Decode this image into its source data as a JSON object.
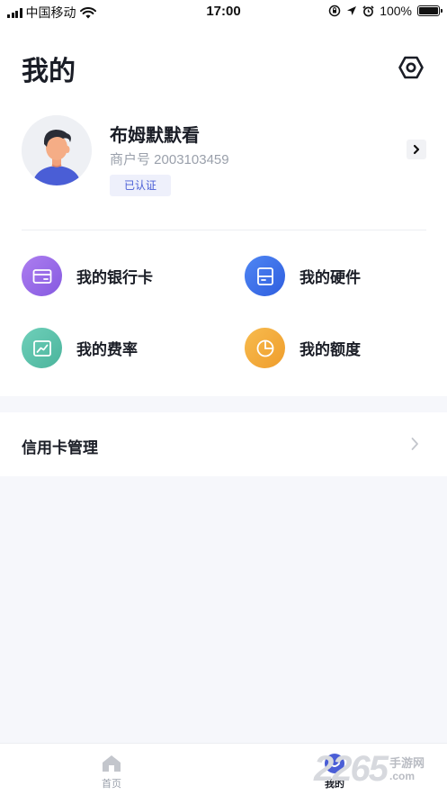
{
  "status_bar": {
    "carrier": "中国移动",
    "time": "17:00",
    "battery": "100%"
  },
  "header": {
    "title": "我的",
    "settings_icon": "settings-icon"
  },
  "profile": {
    "name": "布姆默默看",
    "merchant_no": "商户号 2003103459",
    "badge": "已认证"
  },
  "menu": [
    {
      "label": "我的银行卡",
      "icon": "bank-card-icon",
      "color": "#9b6ee8"
    },
    {
      "label": "我的硬件",
      "icon": "hardware-icon",
      "color": "#3f73ea"
    },
    {
      "label": "我的费率",
      "icon": "rate-chart-icon",
      "color": "#5ec3ae"
    },
    {
      "label": "我的额度",
      "icon": "quota-pie-icon",
      "color": "#f3ab3b"
    }
  ],
  "credit": {
    "label": "信用卡管理"
  },
  "tabbar": {
    "home": "首页",
    "mine": "我的",
    "active_color": "#4a5ed6"
  },
  "watermark": {
    "number": "2265",
    "text": "手游网",
    "domain": ".com"
  }
}
